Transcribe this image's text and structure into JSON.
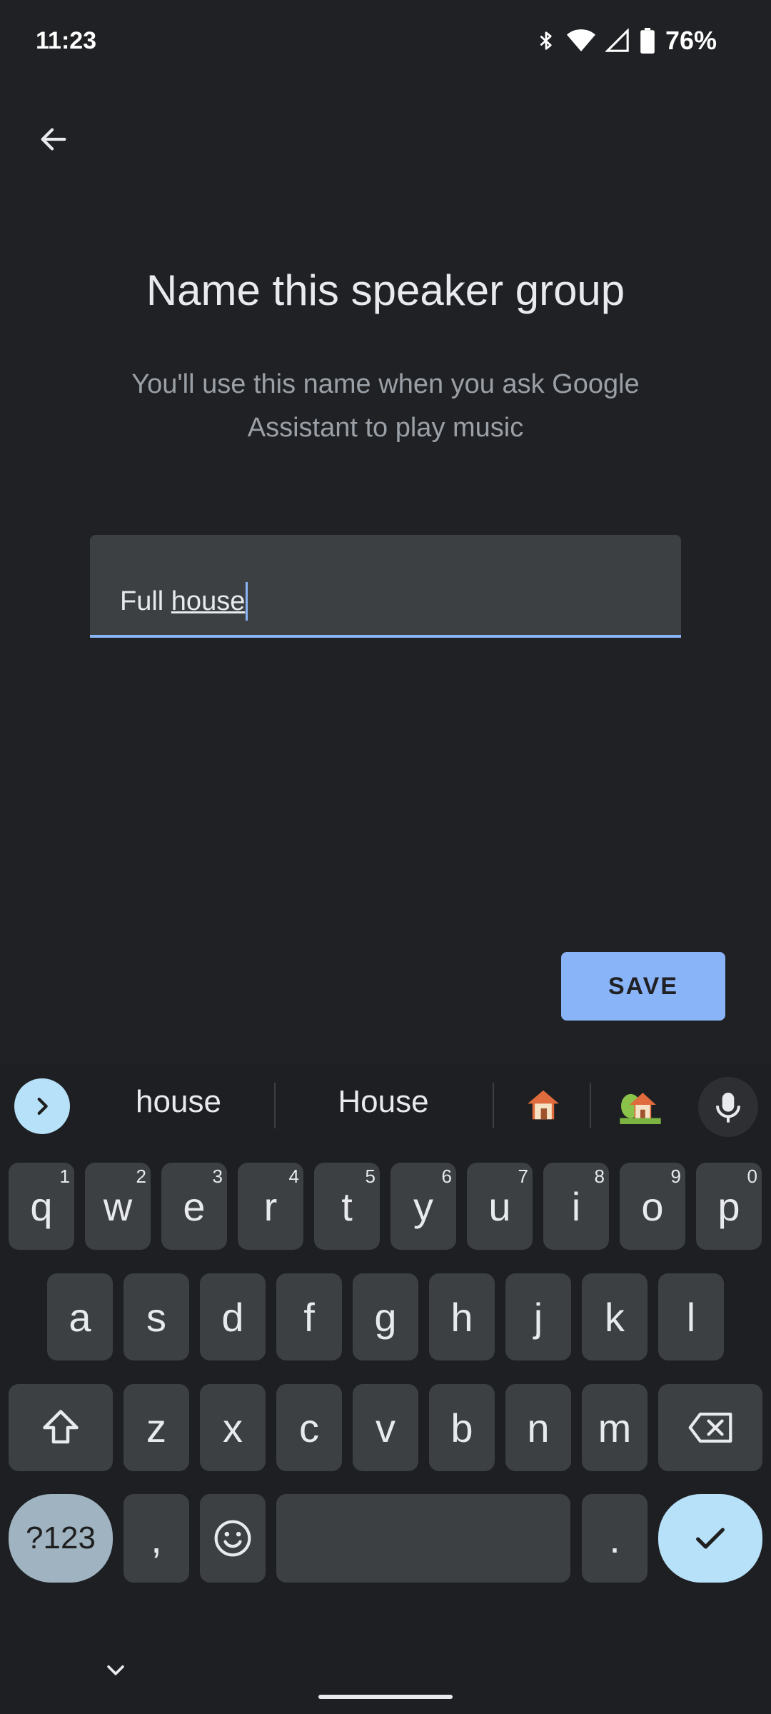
{
  "status_bar": {
    "time": "11:23",
    "battery": "76%"
  },
  "page": {
    "title": "Name this speaker group",
    "subtitle": "You'll use this name when you ask Google Assistant to play music"
  },
  "field": {
    "value_plain": "Full ",
    "value_composing": "house"
  },
  "save_label": "SAVE",
  "keyboard": {
    "suggestions": [
      "house",
      "House"
    ],
    "emoji": [
      "🏠",
      "🏡"
    ],
    "row1": [
      {
        "k": "q",
        "h": "1"
      },
      {
        "k": "w",
        "h": "2"
      },
      {
        "k": "e",
        "h": "3"
      },
      {
        "k": "r",
        "h": "4"
      },
      {
        "k": "t",
        "h": "5"
      },
      {
        "k": "y",
        "h": "6"
      },
      {
        "k": "u",
        "h": "7"
      },
      {
        "k": "i",
        "h": "8"
      },
      {
        "k": "o",
        "h": "9"
      },
      {
        "k": "p",
        "h": "0"
      }
    ],
    "row2": [
      "a",
      "s",
      "d",
      "f",
      "g",
      "h",
      "j",
      "k",
      "l"
    ],
    "row3": [
      "z",
      "x",
      "c",
      "v",
      "b",
      "n",
      "m"
    ],
    "symbols_label": "?123",
    "comma": ",",
    "period": "."
  },
  "icons": {
    "back": "arrow-back-icon",
    "expand": "chevron-right-icon",
    "mic": "mic-icon",
    "shift": "shift-icon",
    "backspace": "backspace-icon",
    "emoji_key": "emoji-icon",
    "enter": "check-icon",
    "hide": "chevron-down-icon"
  },
  "colors": {
    "background": "#202124",
    "accent": "#8ab4f8",
    "field_bg": "#3c4043",
    "key_bg": "#3c4043",
    "enter_bg": "#b6e1f9"
  }
}
